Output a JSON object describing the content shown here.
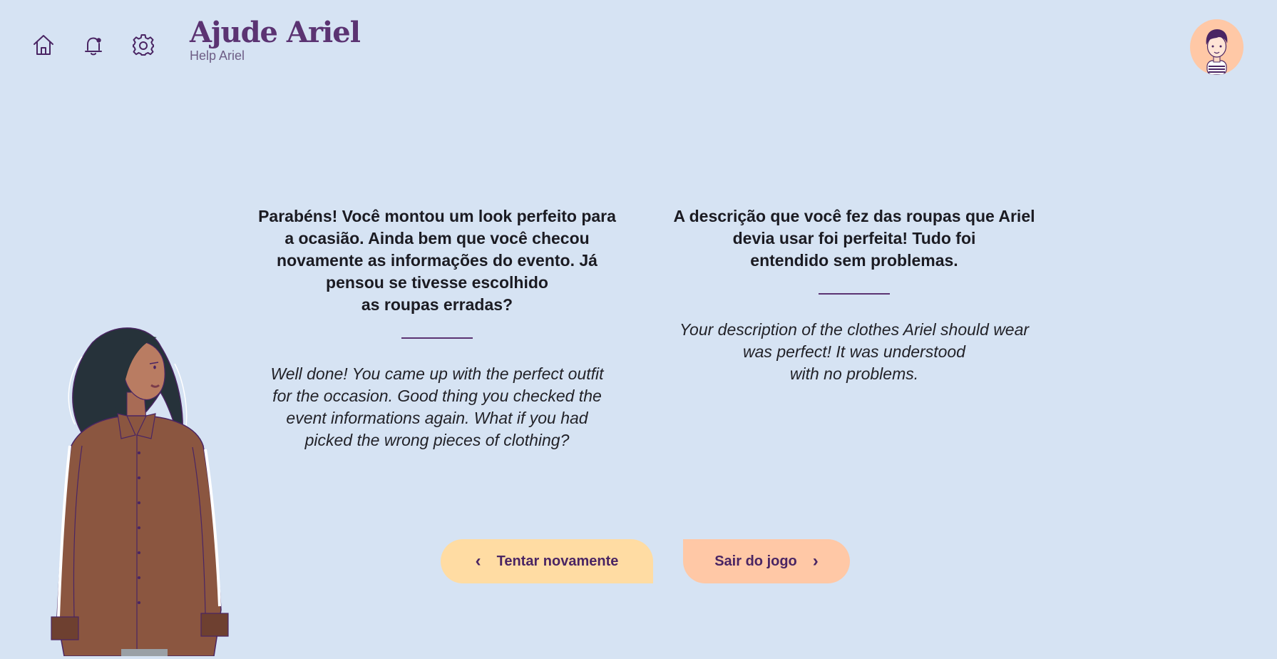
{
  "header": {
    "title": "Ajude Ariel",
    "subtitle": "Help Ariel",
    "nav_icons": [
      "home-icon",
      "bell-notification-icon",
      "gear-icon"
    ]
  },
  "content": {
    "left": {
      "portuguese": "Parabéns! Você montou um look perfeito para\na ocasião. Ainda bem que você checou\nnovamente as informações do evento. Já\npensou se tivesse escolhido\nas roupas erradas?",
      "english": "Well done! You came up with the perfect outfit\nfor the occasion. Good thing you checked the\nevent informations again. What if you had\npicked the wrong pieces of clothing?"
    },
    "right": {
      "portuguese": "A descrição que você fez das roupas que Ariel\ndevia usar foi perfeita! Tudo foi\nentendido sem problemas.",
      "english": "Your description of the clothes Ariel should wear\nwas perfect! It was understood\nwith no problems."
    }
  },
  "buttons": {
    "retry_label": "Tentar novamente",
    "exit_label": "Sair do jogo"
  },
  "colors": {
    "background": "#d6e3f3",
    "accent": "#5b3372",
    "retry_button": "#ffdca3",
    "exit_button": "#ffc8a6"
  }
}
